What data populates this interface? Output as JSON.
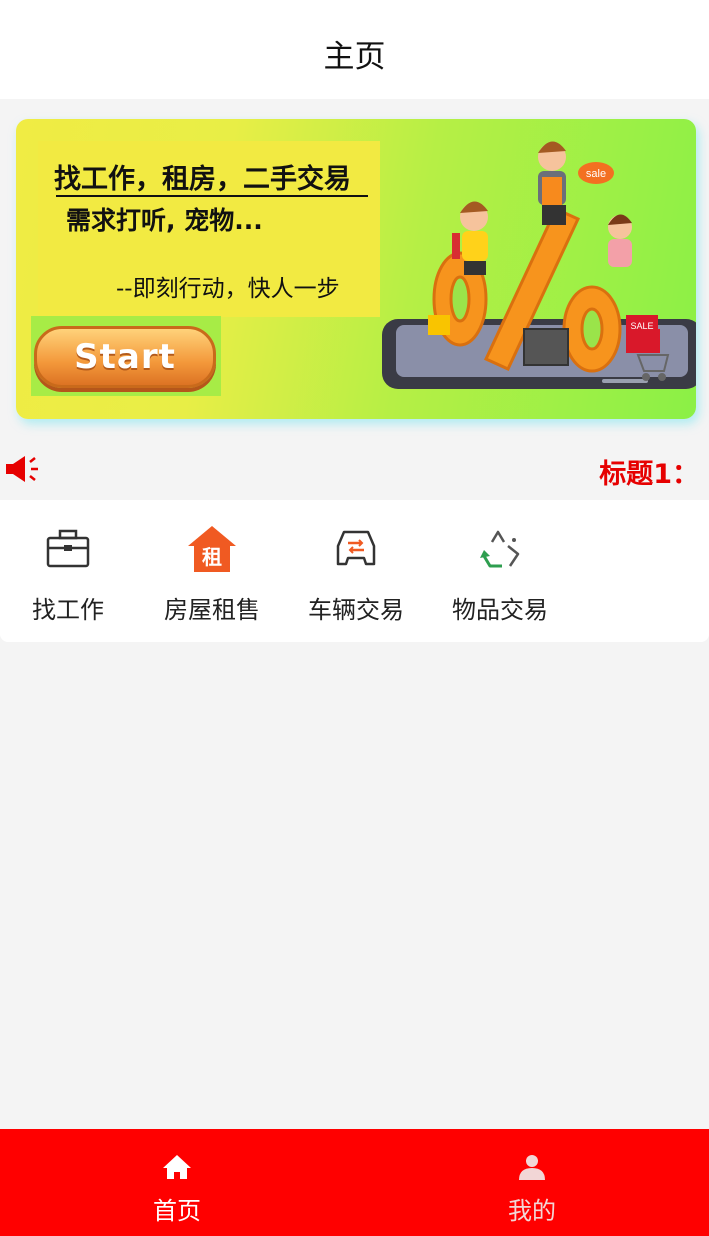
{
  "nav": {
    "title": "主页"
  },
  "banner": {
    "line1": "找工作，租房，二手交易",
    "line2": "需求打听, 宠物...",
    "line3": "--即刻行动，快人一步",
    "start_label": "Start",
    "sale_tag": "sale",
    "sale_box": "SALE"
  },
  "notice": {
    "title": "标题1：",
    "icon": "speaker-icon"
  },
  "menu": [
    {
      "label": "找工作",
      "icon": "briefcase-icon"
    },
    {
      "label": "房屋租售",
      "icon": "rent-house-icon",
      "badge": "租"
    },
    {
      "label": "车辆交易",
      "icon": "car-trade-icon"
    },
    {
      "label": "物品交易",
      "icon": "recycle-icon"
    }
  ],
  "tabbar": {
    "items": [
      {
        "label": "首页",
        "icon": "home-icon",
        "active": true
      },
      {
        "label": "我的",
        "icon": "user-icon",
        "active": false
      }
    ]
  },
  "colors": {
    "accent": "#ff0000",
    "tab_active": "#ffffff",
    "tab_inactive": "#f2d6d6",
    "notice_text": "#e60000",
    "house_orange": "#f05a22"
  }
}
